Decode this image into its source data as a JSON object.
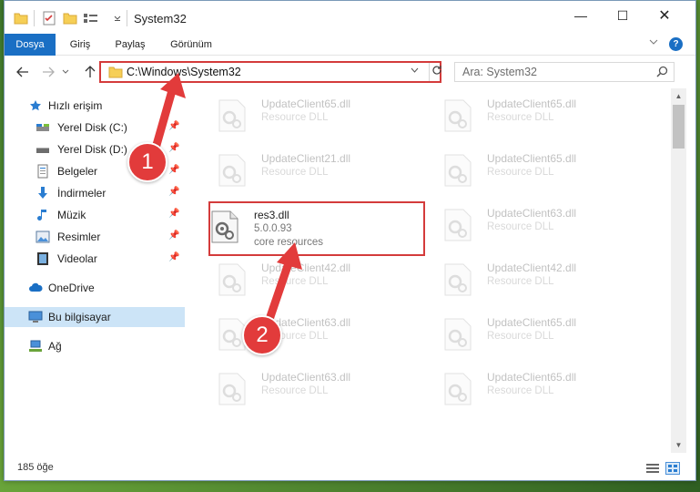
{
  "window": {
    "title": "System32",
    "controls": {
      "minimize": "—",
      "maximize": "☐",
      "close": "✕"
    }
  },
  "ribbon": {
    "tabs": [
      {
        "label": "Dosya"
      },
      {
        "label": "Giriş"
      },
      {
        "label": "Paylaş"
      },
      {
        "label": "Görünüm"
      }
    ],
    "help": "?"
  },
  "navigation": {
    "address": "C:\\Windows\\System32",
    "search_placeholder": "Ara: System32"
  },
  "sidebar": {
    "items": [
      {
        "label": "Hızlı erişim",
        "icon": "star-icon"
      },
      {
        "label": "Yerel Disk (C:)",
        "icon": "drive-icon",
        "pinned": true
      },
      {
        "label": "Yerel Disk (D:)",
        "icon": "drive-icon",
        "pinned": true
      },
      {
        "label": "Belgeler",
        "icon": "documents-icon",
        "pinned": true
      },
      {
        "label": "İndirmeler",
        "icon": "download-icon",
        "pinned": true
      },
      {
        "label": "Müzik",
        "icon": "music-icon",
        "pinned": true
      },
      {
        "label": "Resimler",
        "icon": "pictures-icon",
        "pinned": true
      },
      {
        "label": "Videolar",
        "icon": "video-icon",
        "pinned": true
      },
      {
        "label": "OneDrive",
        "icon": "cloud-icon"
      },
      {
        "label": "Bu bilgisayar",
        "icon": "computer-icon",
        "selected": true
      },
      {
        "label": "Ağ",
        "icon": "network-icon"
      }
    ]
  },
  "files": [
    {
      "name": "UpdateClient65.dll",
      "desc": "Resource DLL"
    },
    {
      "name": "UpdateClient65.dll",
      "desc": "Resource DLL"
    },
    {
      "name": "UpdateClient21.dll",
      "desc": "Resource DLL"
    },
    {
      "name": "UpdateClient65.dll",
      "desc": "Resource DLL"
    },
    {
      "name": "res3.dll",
      "desc": "5.0.0.93",
      "desc2": "core resources"
    },
    {
      "name": "UpdateClient63.dll",
      "desc": "Resource DLL"
    },
    {
      "name": "UpdateClient42.dll",
      "desc": "Resource DLL"
    },
    {
      "name": "UpdateClient42.dll",
      "desc": "Resource DLL"
    },
    {
      "name": "UpdateClient63.dll",
      "desc": "Resource DLL"
    },
    {
      "name": "UpdateClient65.dll",
      "desc": "Resource DLL"
    },
    {
      "name": "UpdateClient63.dll",
      "desc": "Resource DLL"
    },
    {
      "name": "UpdateClient65.dll",
      "desc": "Resource DLL"
    }
  ],
  "status": {
    "count": "185 öğe"
  },
  "annotations": {
    "step1": "1",
    "step2": "2"
  },
  "colors": {
    "accent": "#1a6fc4",
    "highlight": "#d43b3b",
    "selected": "#cce4f7"
  }
}
